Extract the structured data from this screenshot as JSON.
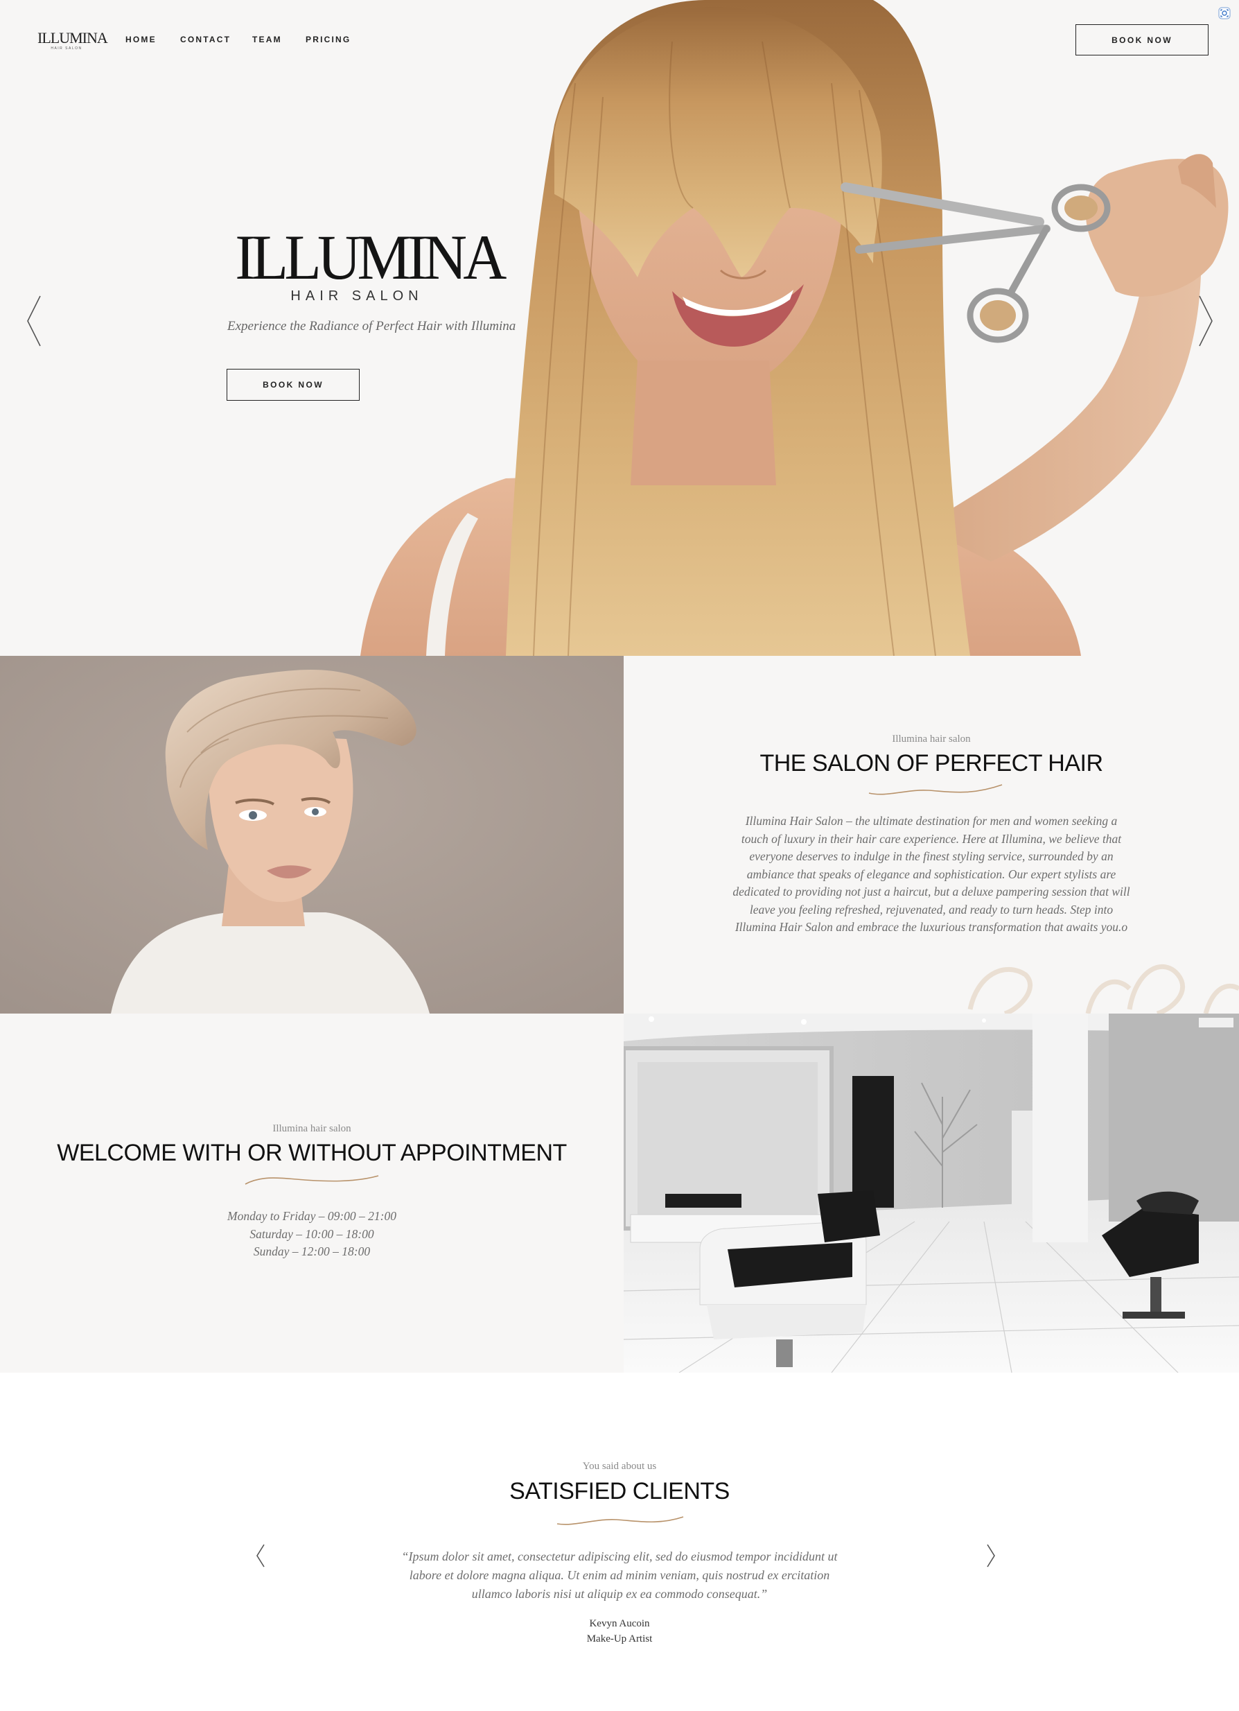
{
  "nav": {
    "logo_text": "ILLUMINA",
    "logo_subtext": "HAIR SALON",
    "links": [
      "HOME",
      "CONTACT",
      "TEAM",
      "PRICING"
    ],
    "book_label": "BOOK NOW"
  },
  "hero": {
    "title": "ILLUMINA",
    "subtitle": "HAIR SALON",
    "tagline": "Experience the Radiance of Perfect Hair with Illumina",
    "book_label": "BOOK NOW"
  },
  "about": {
    "eyebrow": "Illumina hair salon",
    "heading": "THE SALON OF PERFECT HAIR",
    "lines": [
      "Illumina Hair Salon – the ultimate destination for men and women seeking a",
      "touch of luxury in their hair care experience. Here at Illumina, we believe that",
      "everyone deserves to indulge in the finest styling service, surrounded by an",
      "ambiance that speaks of elegance and sophistication. Our expert stylists are",
      "dedicated to providing not just a haircut, but a deluxe pampering session that will",
      "leave you feeling refreshed, rejuvenated, and ready to turn heads. Step into",
      "Illumina Hair Salon and embrace the luxurious transformation that awaits you.o"
    ]
  },
  "welcome": {
    "eyebrow": "Illumina hair salon",
    "heading": "WELCOME WITH OR WITHOUT APPOINTMENT",
    "hours": [
      "Monday to Friday – 09:00 – 21:00",
      "Saturday – 10:00 – 18:00",
      "Sunday – 12:00 – 18:00"
    ]
  },
  "testimonials": {
    "eyebrow": "You said about us",
    "heading": "SATISFIED CLIENTS",
    "quote_lines": [
      "“Ipsum dolor sit amet, consectetur adipiscing elit, sed do eiusmod tempor incididunt ut",
      "labore et dolore magna aliqua. Ut enim ad minim veniam, quis nostrud ex ercitation",
      "ullamco laboris nisi ut aliquip ex ea commodo consequat.”"
    ],
    "author": "Kevyn Aucoin",
    "role": "Make-Up Artist"
  },
  "colors": {
    "accent_gold": "#b8926a",
    "text_dark": "#111111",
    "text_muted": "#6d6d6d",
    "background": "#f7f6f5"
  },
  "icons": [
    "scissors-icon",
    "chevron-left-icon",
    "chevron-right-icon",
    "swash-divider-icon",
    "expand-icon"
  ]
}
